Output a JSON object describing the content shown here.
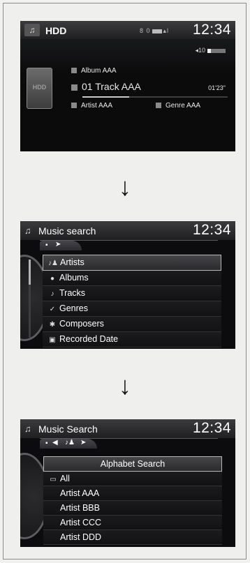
{
  "screen1": {
    "source": "HDD",
    "clock": "12:34",
    "volume": "10",
    "status_text": "8 0",
    "hdd_label": "HDD",
    "album": "Album AAA",
    "track": "01 Track AAA",
    "time": "01'23\"",
    "artist": "Artist AAA",
    "genre": "Genre AAA",
    "progress_fraction": 0.32
  },
  "screen2": {
    "title": "Music search",
    "clock": "12:34",
    "items": [
      "Artists",
      "Albums",
      "Tracks",
      "Genres",
      "Composers",
      "Recorded Date"
    ],
    "selected_index": 0
  },
  "screen3": {
    "title": "Music Search",
    "clock": "12:34",
    "items": [
      "Alphabet Search",
      "All",
      "Artist AAA",
      "Artist BBB",
      "Artist CCC",
      "Artist DDD"
    ],
    "selected_index": 0
  },
  "colors": {
    "screen_bg": "#0c0c0e",
    "highlight_border": "#b8b8ba",
    "text": "#ffffff"
  }
}
